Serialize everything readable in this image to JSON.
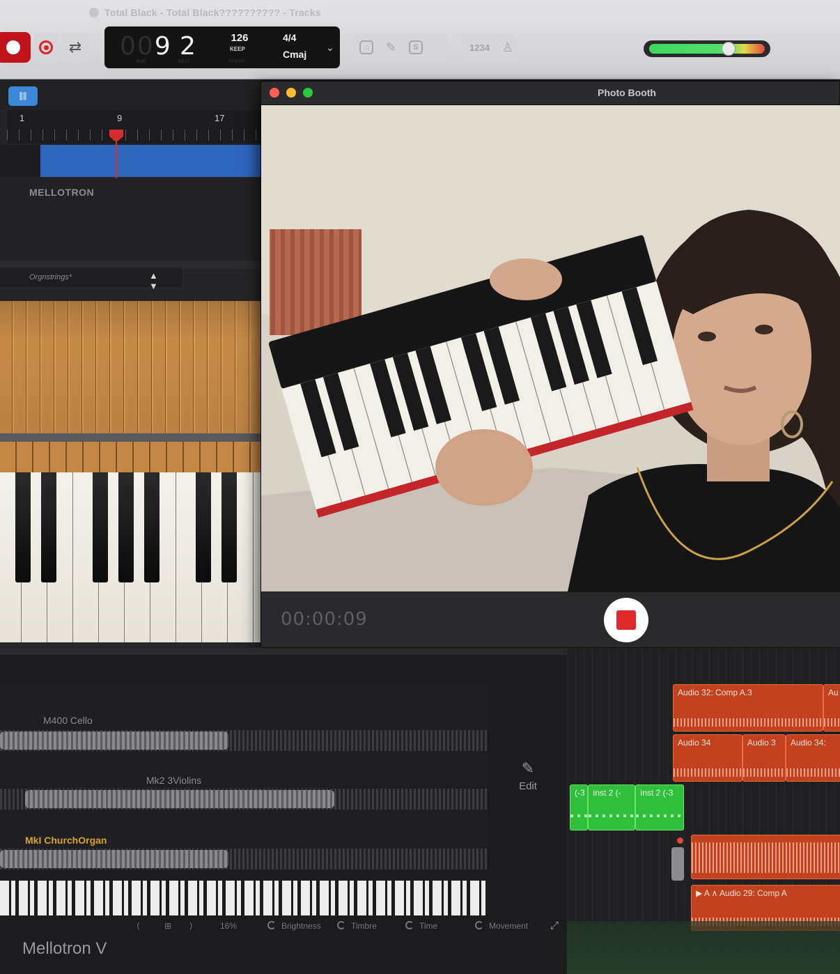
{
  "window": {
    "title": "Total Black - Total Black?????????? - Tracks"
  },
  "toolbar": {
    "record_icon": "record-icon",
    "capture_icon": "capture-recording-icon",
    "cycle_icon": "cycle-icon",
    "lcd": {
      "bar_ghost": "00",
      "bar": "9",
      "beat": "2",
      "bar_caption": "BAR",
      "beat_caption": "BEAT",
      "tempo": "126",
      "tempo_mode": "KEEP",
      "tempo_caption": "TEMPO",
      "time_signature": "4/4",
      "key": "Cmaj"
    },
    "count_in": "1234",
    "accent_color": "#c2121c"
  },
  "plugin": {
    "ruler": [
      "1",
      "9",
      "17"
    ],
    "instrument_name": "MELLOTRON",
    "preset_name": "Orgnstrings*",
    "preset_arrows": "▲ ▼"
  },
  "photo_booth": {
    "title": "Photo Booth",
    "timer": "00:00:09"
  },
  "mellotron": {
    "tapes": [
      {
        "label": "M400 Cello"
      },
      {
        "label": "Mk2 3Violins"
      },
      {
        "label": "MkI ChurchOrgan"
      }
    ],
    "edit_label": "Edit",
    "zoom_percent": "16%",
    "knobs": [
      "Brightness",
      "Timbre",
      "Time",
      "Movement"
    ],
    "footer_title": "Mellotron V"
  },
  "tracks": {
    "regions": [
      {
        "name": "Audio 32: Comp A.3",
        "color": "#c4411f"
      },
      {
        "name": "Au",
        "color": "#c4411f"
      },
      {
        "name": "Audio 34",
        "color": "#c4411f"
      },
      {
        "name": "Audio 3",
        "color": "#c4411f"
      },
      {
        "name": "Audio 34:",
        "color": "#c4411f"
      },
      {
        "name": "(-3",
        "color": "#2fbf3a"
      },
      {
        "name": "Inst 2 (-",
        "color": "#2fbf3a"
      },
      {
        "name": "Inst 2 (-3",
        "color": "#2fbf3a"
      },
      {
        "name": "",
        "color": "#c4411f"
      },
      {
        "name": "▶ A ∧ Audio 29: Comp A",
        "color": "#c4411f"
      }
    ]
  }
}
